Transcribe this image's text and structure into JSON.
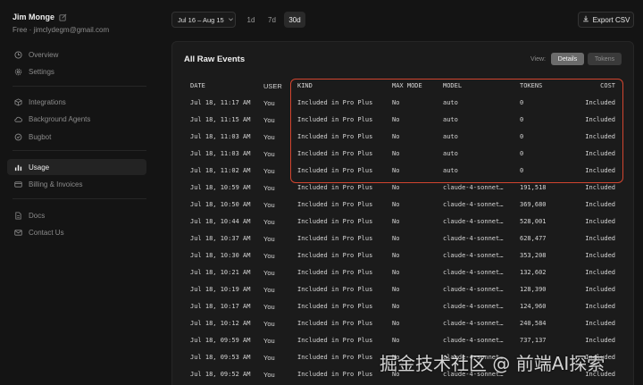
{
  "user": {
    "name": "Jim Monge",
    "plan_email": "Free · jimclydegm@gmail.com"
  },
  "sidebar": {
    "group1": [
      {
        "label": "Overview",
        "icon": "clock-icon"
      },
      {
        "label": "Settings",
        "icon": "gear-icon"
      }
    ],
    "group2": [
      {
        "label": "Integrations",
        "icon": "cube-icon"
      },
      {
        "label": "Background Agents",
        "icon": "cloud-icon"
      },
      {
        "label": "Bugbot",
        "icon": "bug-icon"
      }
    ],
    "group3": [
      {
        "label": "Usage",
        "icon": "bar-chart-icon",
        "active": true
      },
      {
        "label": "Billing & Invoices",
        "icon": "card-icon"
      }
    ],
    "group4": [
      {
        "label": "Docs",
        "icon": "document-icon"
      },
      {
        "label": "Contact Us",
        "icon": "mail-icon"
      }
    ]
  },
  "topbar": {
    "date_range": "Jul 16 – Aug 15",
    "ranges": [
      "1d",
      "7d",
      "30d"
    ],
    "selected_range": "30d",
    "export_label": "Export CSV"
  },
  "panel": {
    "title": "All Raw Events",
    "view_label": "View:",
    "view_options": [
      "Details",
      "Tokens"
    ],
    "selected_view": "Details"
  },
  "table": {
    "headers": {
      "date": "DATE",
      "user": "USER",
      "kind": "KIND",
      "max_mode": "MAX MODE",
      "model": "MODEL",
      "tokens": "TOKENS",
      "cost": "COST"
    },
    "rows": [
      {
        "date": "Jul 18, 11:17 AM",
        "user": "You",
        "kind": "Included in Pro Plus",
        "max_mode": "No",
        "model": "auto",
        "tokens": "0",
        "cost": "Included"
      },
      {
        "date": "Jul 18, 11:15 AM",
        "user": "You",
        "kind": "Included in Pro Plus",
        "max_mode": "No",
        "model": "auto",
        "tokens": "0",
        "cost": "Included"
      },
      {
        "date": "Jul 18, 11:03 AM",
        "user": "You",
        "kind": "Included in Pro Plus",
        "max_mode": "No",
        "model": "auto",
        "tokens": "0",
        "cost": "Included"
      },
      {
        "date": "Jul 18, 11:03 AM",
        "user": "You",
        "kind": "Included in Pro Plus",
        "max_mode": "No",
        "model": "auto",
        "tokens": "0",
        "cost": "Included"
      },
      {
        "date": "Jul 18, 11:02 AM",
        "user": "You",
        "kind": "Included in Pro Plus",
        "max_mode": "No",
        "model": "auto",
        "tokens": "0",
        "cost": "Included"
      },
      {
        "date": "Jul 18, 10:59 AM",
        "user": "You",
        "kind": "Included in Pro Plus",
        "max_mode": "No",
        "model": "claude-4-sonnet…",
        "tokens": "191,518",
        "cost": "Included"
      },
      {
        "date": "Jul 18, 10:50 AM",
        "user": "You",
        "kind": "Included in Pro Plus",
        "max_mode": "No",
        "model": "claude-4-sonnet…",
        "tokens": "369,680",
        "cost": "Included"
      },
      {
        "date": "Jul 18, 10:44 AM",
        "user": "You",
        "kind": "Included in Pro Plus",
        "max_mode": "No",
        "model": "claude-4-sonnet…",
        "tokens": "528,001",
        "cost": "Included"
      },
      {
        "date": "Jul 18, 10:37 AM",
        "user": "You",
        "kind": "Included in Pro Plus",
        "max_mode": "No",
        "model": "claude-4-sonnet…",
        "tokens": "628,477",
        "cost": "Included"
      },
      {
        "date": "Jul 18, 10:30 AM",
        "user": "You",
        "kind": "Included in Pro Plus",
        "max_mode": "No",
        "model": "claude-4-sonnet…",
        "tokens": "353,208",
        "cost": "Included"
      },
      {
        "date": "Jul 18, 10:21 AM",
        "user": "You",
        "kind": "Included in Pro Plus",
        "max_mode": "No",
        "model": "claude-4-sonnet…",
        "tokens": "132,602",
        "cost": "Included"
      },
      {
        "date": "Jul 18, 10:19 AM",
        "user": "You",
        "kind": "Included in Pro Plus",
        "max_mode": "No",
        "model": "claude-4-sonnet…",
        "tokens": "128,390",
        "cost": "Included"
      },
      {
        "date": "Jul 18, 10:17 AM",
        "user": "You",
        "kind": "Included in Pro Plus",
        "max_mode": "No",
        "model": "claude-4-sonnet…",
        "tokens": "124,960",
        "cost": "Included"
      },
      {
        "date": "Jul 18, 10:12 AM",
        "user": "You",
        "kind": "Included in Pro Plus",
        "max_mode": "No",
        "model": "claude-4-sonnet…",
        "tokens": "240,584",
        "cost": "Included"
      },
      {
        "date": "Jul 18, 09:59 AM",
        "user": "You",
        "kind": "Included in Pro Plus",
        "max_mode": "No",
        "model": "claude-4-sonnet…",
        "tokens": "737,137",
        "cost": "Included"
      },
      {
        "date": "Jul 18, 09:53 AM",
        "user": "You",
        "kind": "Included in Pro Plus",
        "max_mode": "No",
        "model": "claude-4-sonnet…",
        "tokens": "",
        "cost": "Included"
      },
      {
        "date": "Jul 18, 09:52 AM",
        "user": "You",
        "kind": "Included in Pro Plus",
        "max_mode": "No",
        "model": "claude-4-sonnet…",
        "tokens": "",
        "cost": "Included"
      }
    ]
  },
  "watermark": "掘金技术社区 @ 前端AI探索",
  "colors": {
    "background": "#141414",
    "panel": "#1b1b1b",
    "highlight": "#d2452f"
  }
}
